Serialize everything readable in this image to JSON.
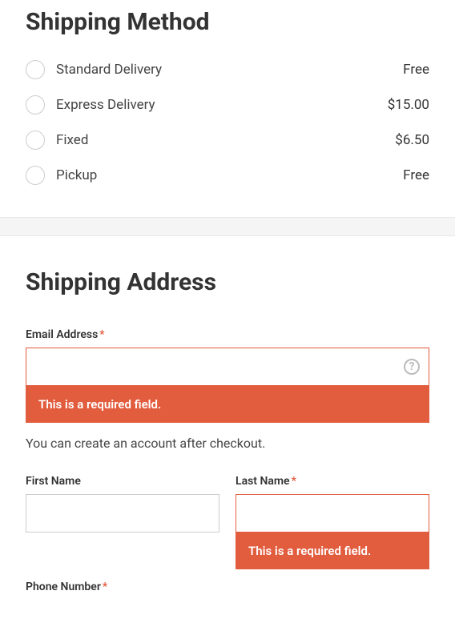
{
  "shippingMethod": {
    "title": "Shipping Method",
    "options": [
      {
        "label": "Standard Delivery",
        "price": "Free"
      },
      {
        "label": "Express Delivery",
        "price": "$15.00"
      },
      {
        "label": "Fixed",
        "price": "$6.50"
      },
      {
        "label": "Pickup",
        "price": "Free"
      }
    ]
  },
  "shippingAddress": {
    "title": "Shipping Address",
    "email": {
      "label": "Email Address",
      "required": true,
      "value": "",
      "error": "This is a required field."
    },
    "helper": "You can create an account after checkout.",
    "firstName": {
      "label": "First Name",
      "required": false,
      "value": ""
    },
    "lastName": {
      "label": "Last Name",
      "required": true,
      "value": "",
      "error": "This is a required field."
    },
    "phone": {
      "label": "Phone Number",
      "required": true
    }
  },
  "requiredMark": "*"
}
